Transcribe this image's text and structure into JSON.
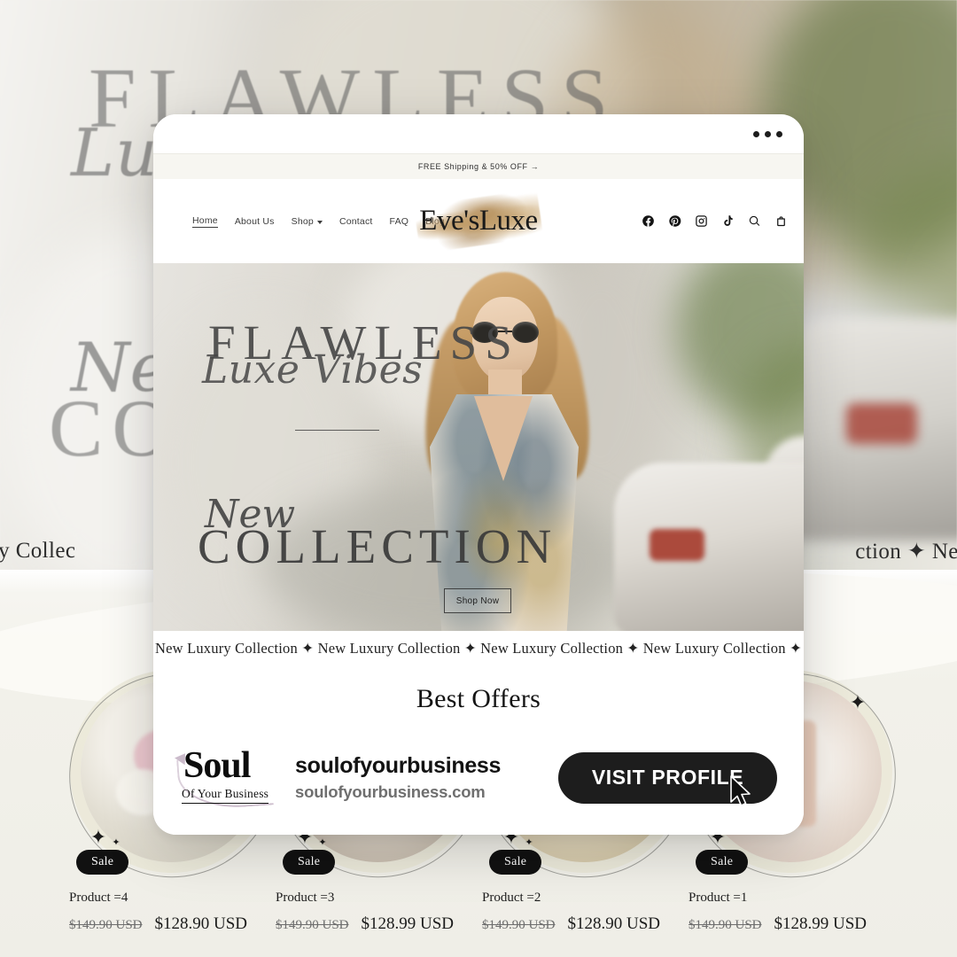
{
  "background": {
    "hero_heading_line1": "FLAWLESS",
    "hero_heading_script": "Luxe",
    "hero_heading_script2": "New",
    "hero_heading_line2": "COLLECTION",
    "marquee_left": "New Luxury Collec",
    "marquee_right": "ction ✦ New Luxur",
    "products": [
      {
        "badge": "Sale",
        "title": "Product =4",
        "price_old": "$149.90 USD",
        "price_new": "$128.90 USD"
      },
      {
        "badge": "Sale",
        "title": "Product =3",
        "price_old": "$149.90 USD",
        "price_new": "$128.99 USD"
      },
      {
        "badge": "Sale",
        "title": "Product =2",
        "price_old": "$149.90 USD",
        "price_new": "$128.90 USD"
      },
      {
        "badge": "Sale",
        "title": "Product =1",
        "price_old": "$149.90 USD",
        "price_new": "$128.99 USD"
      }
    ]
  },
  "mock": {
    "overflow_menu": "•••",
    "announcement": "FREE Shipping & 50% OFF  →",
    "nav": [
      {
        "label": "Home",
        "active": true,
        "has_caret": false
      },
      {
        "label": "About Us",
        "active": false,
        "has_caret": false
      },
      {
        "label": "Shop",
        "active": false,
        "has_caret": true
      },
      {
        "label": "Contact",
        "active": false,
        "has_caret": false
      },
      {
        "label": "FAQ",
        "active": false,
        "has_caret": false
      },
      {
        "label": "Blog",
        "active": false,
        "has_caret": false
      }
    ],
    "brand": "Eve'sLuxe",
    "header_icons": [
      "facebook-icon",
      "pinterest-icon",
      "instagram-icon",
      "tiktok-icon",
      "search-icon",
      "shopping-bag-icon"
    ],
    "hero": {
      "headline_top": "FLAWLESS",
      "script_top": "Luxe Vibes",
      "script_bottom": "New",
      "headline_bottom": "COLLECTION",
      "cta_label": "Shop Now"
    },
    "marquee_text": "New Luxury Collection  ✦  New Luxury Collection  ✦  New Luxury Collection  ✦  New Luxury Collection  ✦  New Luxur",
    "section_title": "Best Offers"
  },
  "cta": {
    "logo_main": "Soul",
    "logo_sub": "Of Your Business",
    "handle": "soulofyourbusiness",
    "domain": "soulofyourbusiness.com",
    "button_label": "VISIT PROFILE"
  },
  "colors": {
    "accent_dark": "#1d1d1d",
    "panel_white": "#ffffff",
    "page_bg": "#f2f1ec",
    "announce_bg": "#f7f6f1",
    "muted_text": "#6f6f6f",
    "gold_splatter": "#be9862"
  }
}
